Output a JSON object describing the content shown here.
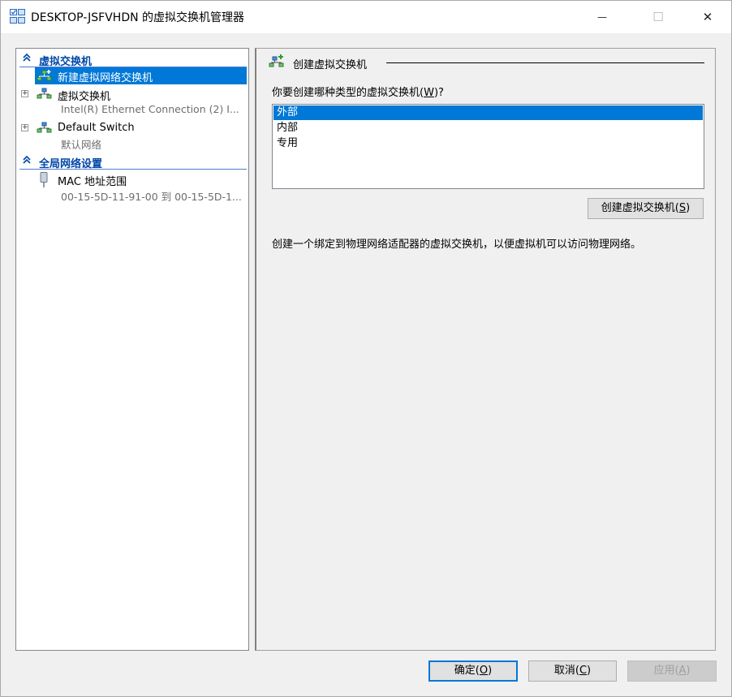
{
  "window": {
    "title": "DESKTOP-JSFVHDN 的虚拟交换机管理器",
    "minimize_glyph": "—",
    "maximize_glyph": "☐",
    "close_glyph": "✕"
  },
  "left_pane": {
    "section_switches": "虚拟交换机",
    "new_switch": "新建虚拟网络交换机",
    "switch1_name": "虚拟交换机",
    "switch1_sub": "Intel(R) Ethernet Connection (2) I...",
    "switch2_name": "Default Switch",
    "switch2_sub": "默认网络",
    "section_global": "全局网络设置",
    "mac_name": "MAC 地址范围",
    "mac_sub": "00-15-5D-11-91-00 到 00-15-5D-1..."
  },
  "right_pane": {
    "panel_title": "创建虚拟交换机",
    "question_prefix": "你要创建哪种类型的虚拟交换机(",
    "question_key": "W",
    "question_suffix": ")?",
    "types": [
      "外部",
      "内部",
      "专用"
    ],
    "create_prefix": "创建虚拟交换机(",
    "create_key": "S",
    "create_suffix": ")",
    "description": "创建一个绑定到物理网络适配器的虚拟交换机，以便虚拟机可以访问物理网络。"
  },
  "footer": {
    "ok_prefix": "确定(",
    "ok_key": "O",
    "ok_suffix": ")",
    "cancel_prefix": "取消(",
    "cancel_key": "C",
    "cancel_suffix": ")",
    "apply_prefix": "应用(",
    "apply_key": "A",
    "apply_suffix": ")"
  },
  "colors": {
    "selection": "#0078d7",
    "section_header": "#0046a8",
    "disabled_text": "#a0a0a0"
  }
}
